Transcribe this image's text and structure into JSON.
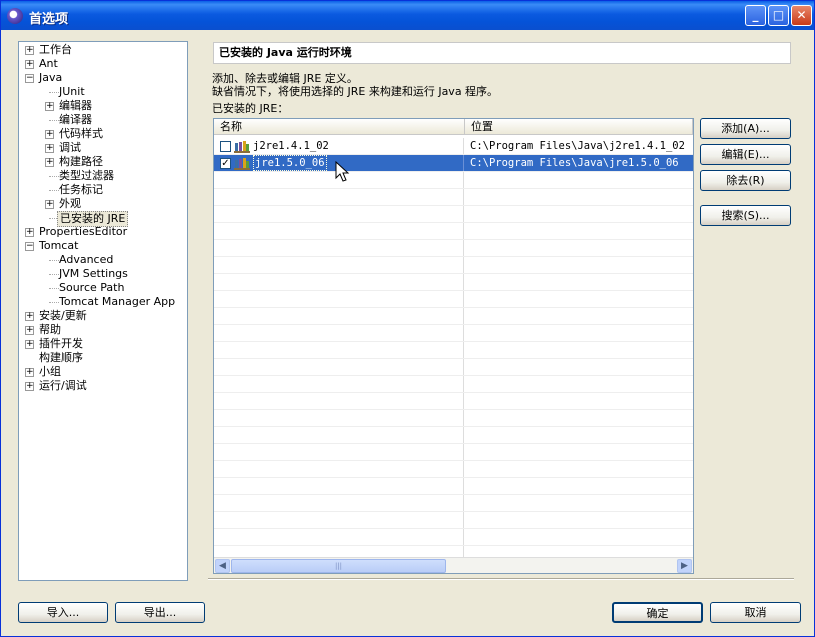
{
  "window": {
    "title": "首选项"
  },
  "tree": [
    {
      "label": "工作台",
      "level": 0,
      "expander": "+"
    },
    {
      "label": "Ant",
      "level": 0,
      "expander": "+"
    },
    {
      "label": "Java",
      "level": 0,
      "expander": "−"
    },
    {
      "label": "JUnit",
      "level": 1,
      "expander": ""
    },
    {
      "label": "编辑器",
      "level": 1,
      "expander": "+"
    },
    {
      "label": "编译器",
      "level": 1,
      "expander": ""
    },
    {
      "label": "代码样式",
      "level": 1,
      "expander": "+"
    },
    {
      "label": "调试",
      "level": 1,
      "expander": "+"
    },
    {
      "label": "构建路径",
      "level": 1,
      "expander": "+"
    },
    {
      "label": "类型过滤器",
      "level": 1,
      "expander": ""
    },
    {
      "label": "任务标记",
      "level": 1,
      "expander": ""
    },
    {
      "label": "外观",
      "level": 1,
      "expander": "+"
    },
    {
      "label": "已安装的 JRE",
      "level": 1,
      "expander": "",
      "selected": true
    },
    {
      "label": "PropertiesEditor",
      "level": 0,
      "expander": "+"
    },
    {
      "label": "Tomcat",
      "level": 0,
      "expander": "−"
    },
    {
      "label": "Advanced",
      "level": 1,
      "expander": ""
    },
    {
      "label": "JVM Settings",
      "level": 1,
      "expander": ""
    },
    {
      "label": "Source Path",
      "level": 1,
      "expander": ""
    },
    {
      "label": "Tomcat Manager App",
      "level": 1,
      "expander": ""
    },
    {
      "label": "安装/更新",
      "level": 0,
      "expander": "+"
    },
    {
      "label": "帮助",
      "level": 0,
      "expander": "+"
    },
    {
      "label": "插件开发",
      "level": 0,
      "expander": "+"
    },
    {
      "label": "构建顺序",
      "level": 0,
      "expander": ""
    },
    {
      "label": "小组",
      "level": 0,
      "expander": "+"
    },
    {
      "label": "运行/调试",
      "level": 0,
      "expander": "+"
    }
  ],
  "page": {
    "header": "已安装的 Java 运行时环境",
    "desc1": "添加、除去或编辑 JRE 定义。",
    "desc2": "缺省情况下，将使用选择的 JRE 来构建和运行 Java 程序。",
    "list_label": "已安装的 JRE："
  },
  "table": {
    "columns": [
      "名称",
      "位置"
    ],
    "rows": [
      {
        "name": "j2re1.4.1_02",
        "location": "C:\\Program Files\\Java\\j2re1.4.1_02",
        "checked": false,
        "selected": false
      },
      {
        "name": "jre1.5.0_06",
        "location": "C:\\Program Files\\Java\\jre1.5.0_06",
        "checked": true,
        "selected": true
      }
    ]
  },
  "buttons": {
    "add": "添加(A)...",
    "edit": "编辑(E)...",
    "remove": "除去(R)",
    "search": "搜索(S)...",
    "import": "导入...",
    "export": "导出...",
    "ok": "确定",
    "cancel": "取消"
  },
  "colors": {
    "titlebar": "#0553d8",
    "selection": "#316ac5",
    "dialog_bg": "#ece9d8"
  }
}
